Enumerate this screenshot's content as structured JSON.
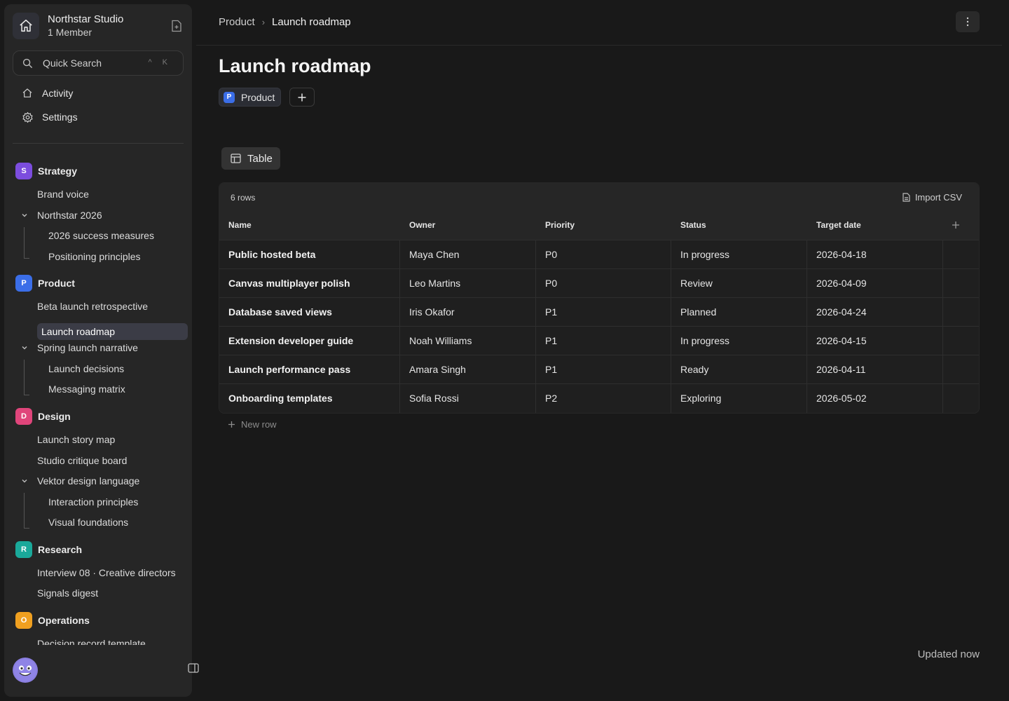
{
  "workspace": {
    "name": "Northstar Studio",
    "members": "1 Member"
  },
  "search": {
    "label": "Quick Search",
    "shortcut": "^ K"
  },
  "nav": [
    {
      "label": "Activity",
      "icon": "home-icon"
    },
    {
      "label": "Settings",
      "icon": "gear-icon"
    }
  ],
  "groups": {
    "strategy": {
      "badge": "S",
      "name": "Strategy",
      "color": "#7c4dde",
      "items": {
        "brand_voice": "Brand voice",
        "northstar_2026": "Northstar 2026",
        "success_measures": "2026 success measures",
        "positioning": "Positioning principles"
      }
    },
    "product": {
      "badge": "P",
      "name": "Product",
      "color": "#3b6ee8",
      "items": {
        "retro": "Beta launch retrospective",
        "roadmap": "Launch roadmap",
        "spring": "Spring launch narrative",
        "decisions": "Launch decisions",
        "matrix": "Messaging matrix"
      }
    },
    "design": {
      "badge": "D",
      "name": "Design",
      "color": "#e0457b",
      "items": {
        "story_map": "Launch story map",
        "critique": "Studio critique board",
        "vektor": "Vektor design language",
        "interaction": "Interaction principles",
        "visual": "Visual foundations"
      }
    },
    "research": {
      "badge": "R",
      "name": "Research",
      "color": "#1aa99a",
      "items": {
        "interview": "Interview 08 · Creative directors",
        "signals": "Signals digest"
      }
    },
    "operations": {
      "badge": "O",
      "name": "Operations",
      "color": "#f0a020",
      "items": {
        "decision_record": "Decision record template"
      }
    }
  },
  "breadcrumb": {
    "parent": "Product",
    "current": "Launch roadmap"
  },
  "page": {
    "title": "Launch roadmap",
    "tag_badge": "P",
    "tag_label": "Product"
  },
  "view": {
    "tab_label": "Table"
  },
  "table": {
    "row_count": "6 rows",
    "import_label": "Import CSV",
    "columns": [
      "Name",
      "Owner",
      "Priority",
      "Status",
      "Target date"
    ],
    "rows": [
      [
        "Public hosted beta",
        "Maya Chen",
        "P0",
        "In progress",
        "2026-04-18"
      ],
      [
        "Canvas multiplayer polish",
        "Leo Martins",
        "P0",
        "Review",
        "2026-04-09"
      ],
      [
        "Database saved views",
        "Iris Okafor",
        "P1",
        "Planned",
        "2026-04-24"
      ],
      [
        "Extension developer guide",
        "Noah Williams",
        "P1",
        "In progress",
        "2026-04-15"
      ],
      [
        "Launch performance pass",
        "Amara Singh",
        "P1",
        "Ready",
        "2026-04-11"
      ],
      [
        "Onboarding templates",
        "Sofia Rossi",
        "P2",
        "Exploring",
        "2026-05-02"
      ]
    ],
    "new_row_label": "New row"
  },
  "footer": {
    "status": "Updated now"
  }
}
